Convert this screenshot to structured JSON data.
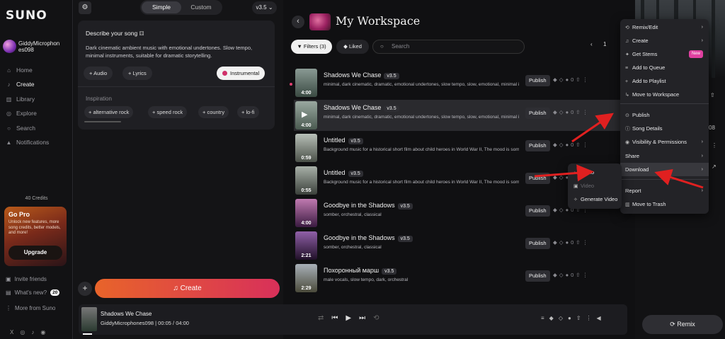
{
  "sidebar": {
    "logo": "SUNO",
    "username": "GiddyMicrophon es098",
    "nav": [
      {
        "label": "Home",
        "icon": "home-icon"
      },
      {
        "label": "Create",
        "icon": "create-icon"
      },
      {
        "label": "Library",
        "icon": "library-icon"
      },
      {
        "label": "Explore",
        "icon": "explore-icon"
      },
      {
        "label": "Search",
        "icon": "search-icon"
      },
      {
        "label": "Notifications",
        "icon": "bell-icon"
      }
    ],
    "credits": "40 Credits",
    "gopro": {
      "title": "Go Pro",
      "desc": "Unlock new features, more song credits, better models, and more!",
      "button": "Upgrade"
    },
    "bottom": {
      "invite": "Invite friends",
      "whats_new": "What's new?",
      "whats_new_count": "20",
      "more": "More from Suno"
    }
  },
  "create": {
    "tab_simple": "Simple",
    "tab_custom": "Custom",
    "version": "v3.5",
    "describe_label": "Describe your song",
    "description": "Dark cinematic ambient music with emotional undertones. Slow tempo, minimal instruments, suitable for dramatic storytelling.",
    "chip_audio": "Audio",
    "chip_lyrics": "Lyrics",
    "chip_instrumental": "Instrumental",
    "inspiration_label": "Inspiration",
    "inspiration": [
      "alternative rock",
      "speed rock",
      "country",
      "lo-fi"
    ],
    "create_button": "Create"
  },
  "workspace": {
    "title": "My Workspace",
    "filters": "Filters (3)",
    "liked": "Liked",
    "search_placeholder": "Search",
    "page": "1",
    "publish_label": "Publish",
    "like_count": "0",
    "songs": [
      {
        "title": "Shadows We Chase",
        "version": "v3.5",
        "tags": "minimal, dark cinematic, dramatic, emotional undertones, slow tempo, slow, emotional, minimal instr...",
        "duration": "4:00"
      },
      {
        "title": "Shadows We Chase",
        "version": "v3.5",
        "tags": "minimal, dark cinematic, dramatic, emotional undertones, slow tempo, slow, emotional, minimal inst...",
        "duration": "4:00"
      },
      {
        "title": "Untitled",
        "version": "v3.5",
        "tags": "Background music for a historical short film about child heroes in World War II, The mood is somber...",
        "duration": "0:59"
      },
      {
        "title": "Untitled",
        "version": "v3.5",
        "tags": "Background music for a historical short film about child heroes in World War II, The mood is somber...",
        "duration": "0:55"
      },
      {
        "title": "Goodbye in the Shadows",
        "version": "v3.5",
        "tags": "somber, orchestral, classical",
        "duration": "4:00"
      },
      {
        "title": "Goodbye in the Shadows",
        "version": "v3.5",
        "tags": "somber, orchestral, classical",
        "duration": "2:21"
      },
      {
        "title": "Похоронный марш",
        "version": "v3.5",
        "tags": "male vocals, slow tempo, dark, orchestral",
        "duration": "2:29"
      }
    ]
  },
  "context_menu": {
    "items": [
      {
        "label": "Remix/Edit",
        "submenu": true
      },
      {
        "label": "Create",
        "submenu": true
      },
      {
        "label": "Get Stems",
        "badge": "New"
      },
      {
        "label": "Add to Queue"
      },
      {
        "label": "Add to Playlist"
      },
      {
        "label": "Move to Workspace"
      },
      {
        "label": "Publish"
      },
      {
        "label": "Song Details"
      },
      {
        "label": "Visibility & Permissions",
        "submenu": true
      },
      {
        "label": "Share",
        "submenu": true
      },
      {
        "label": "Download",
        "submenu": true
      },
      {
        "label": "Report",
        "submenu": true
      },
      {
        "label": "Move to Trash"
      }
    ]
  },
  "download_submenu": {
    "audio": "Audio",
    "video": "Video",
    "generate_video": "Generate Video"
  },
  "player": {
    "title": "Shadows We Chase",
    "user": "GiddyMicrophones098",
    "time": "00:05 / 04:00",
    "progress": 0.021
  },
  "right_panel": {
    "remix": "Remix",
    "partial_text": "08"
  },
  "colors": {
    "accent_pink": "#e040a0",
    "create_gradient_start": "#e8642a",
    "create_gradient_end": "#d8305a",
    "annotation_arrow": "#e02020"
  }
}
